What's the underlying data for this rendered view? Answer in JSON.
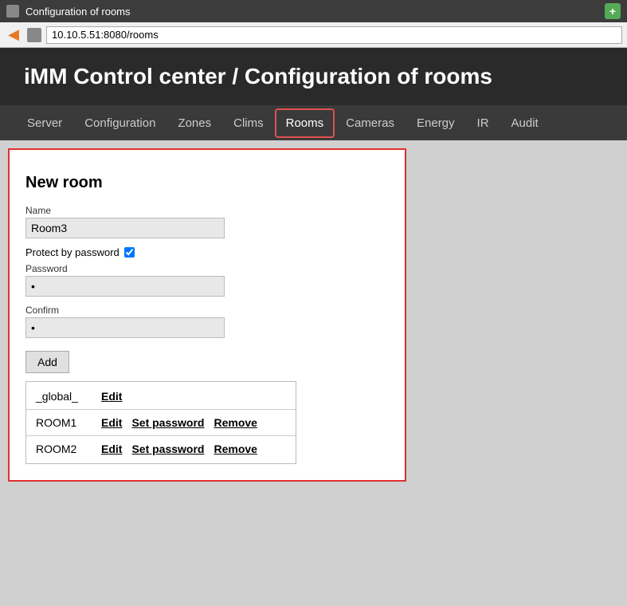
{
  "titlebar": {
    "icon": "browser-icon",
    "text": "Configuration of rooms",
    "new_tab_label": "+"
  },
  "addressbar": {
    "back_label": "◄",
    "url": "10.10.5.51:8080/rooms"
  },
  "header": {
    "title": "iMM Control center / Configuration of rooms"
  },
  "nav": {
    "items": [
      {
        "label": "Server",
        "active": false
      },
      {
        "label": "Configuration",
        "active": false
      },
      {
        "label": "Zones",
        "active": false
      },
      {
        "label": "Clims",
        "active": false
      },
      {
        "label": "Rooms",
        "active": true
      },
      {
        "label": "Cameras",
        "active": false
      },
      {
        "label": "Energy",
        "active": false
      },
      {
        "label": "IR",
        "active": false
      },
      {
        "label": "Audit",
        "active": false
      }
    ]
  },
  "form": {
    "title": "New room",
    "name_label": "Name",
    "name_value": "Room3",
    "protect_label": "Protect by password",
    "protect_checked": true,
    "password_label": "Password",
    "password_value": "•",
    "confirm_label": "Confirm",
    "confirm_value": "•",
    "add_button": "Add"
  },
  "rooms": [
    {
      "name": "_global_",
      "actions": [
        "Edit"
      ],
      "has_set_password": false,
      "has_remove": false
    },
    {
      "name": "ROOM1",
      "actions": [
        "Edit",
        "Set password",
        "Remove"
      ],
      "has_set_password": true,
      "has_remove": true
    },
    {
      "name": "ROOM2",
      "actions": [
        "Edit",
        "Set password",
        "Remove"
      ],
      "has_set_password": true,
      "has_remove": true
    }
  ]
}
